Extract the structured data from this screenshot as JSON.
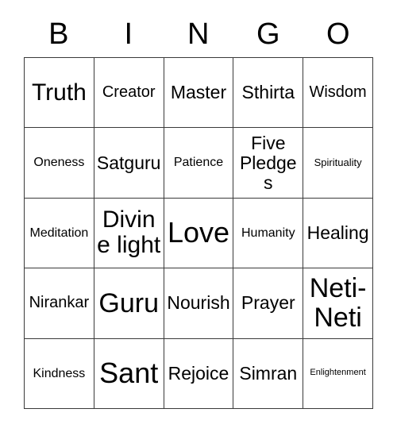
{
  "header": {
    "letters": [
      "B",
      "I",
      "N",
      "G",
      "O"
    ]
  },
  "grid": {
    "rows": 5,
    "columns": 5,
    "border_color": "#3a3a3a",
    "background_color": "#ffffff",
    "text_color": "#000000",
    "cells": [
      [
        {
          "label": "Truth",
          "size": "fs-l"
        },
        {
          "label": "Creator",
          "size": "fs-s"
        },
        {
          "label": "Master",
          "size": "fs-m"
        },
        {
          "label": "Sthirta",
          "size": "fs-m"
        },
        {
          "label": "Wisdom",
          "size": "fs-s"
        }
      ],
      [
        {
          "label": "Oneness",
          "size": "fs-xs"
        },
        {
          "label": "Satguru",
          "size": "fs-m"
        },
        {
          "label": "Patience",
          "size": "fs-xs"
        },
        {
          "label": "Five Pledges",
          "size": "fs-m"
        },
        {
          "label": "Spirituality",
          "size": "fs-xxs"
        }
      ],
      [
        {
          "label": "Meditation",
          "size": "fs-xs"
        },
        {
          "label": "Divine light",
          "size": "fs-l"
        },
        {
          "label": "Love",
          "size": "fs-xxl"
        },
        {
          "label": "Humanity",
          "size": "fs-xs"
        },
        {
          "label": "Healing",
          "size": "fs-m"
        }
      ],
      [
        {
          "label": "Nirankar",
          "size": "fs-s"
        },
        {
          "label": "Guru",
          "size": "fs-xl"
        },
        {
          "label": "Nourish",
          "size": "fs-m"
        },
        {
          "label": "Prayer",
          "size": "fs-m"
        },
        {
          "label": "Neti-Neti",
          "size": "fs-xl"
        }
      ],
      [
        {
          "label": "Kindness",
          "size": "fs-xs"
        },
        {
          "label": "Sant",
          "size": "fs-xxl"
        },
        {
          "label": "Rejoice",
          "size": "fs-m"
        },
        {
          "label": "Simran",
          "size": "fs-m"
        },
        {
          "label": "Enlightenment",
          "size": "fs-tiny"
        }
      ]
    ]
  }
}
